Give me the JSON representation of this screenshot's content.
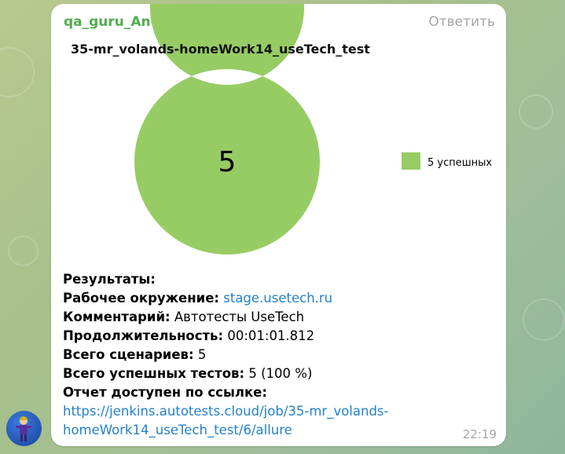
{
  "message": {
    "sender": "qa_guru_AndreQa_bot",
    "reply_label": "Ответить",
    "time": "22:19"
  },
  "chart_data": {
    "type": "pie",
    "title": "35-mr_volands-homeWork14_useTech_test",
    "center_label": "5",
    "slices": [
      {
        "name": "5 успешных",
        "value": 5,
        "color": "#97cc64"
      }
    ]
  },
  "report": {
    "results_label": "Результаты:",
    "env_label": "Рабочее окружение:",
    "env_value": "stage.usetech.ru",
    "comment_label": "Комментарий:",
    "comment_value": "Автотесты UseTech",
    "duration_label": "Продолжительность:",
    "duration_value": "00:01:01.812",
    "scenarios_label": "Всего сценариев:",
    "scenarios_value": "5",
    "passed_label": "Всего успешных тестов:",
    "passed_value": "5 (100 %)",
    "link_label": "Отчет доступен по ссылке:",
    "link_line1": "https://jenkins.autotests.cloud/job/35-mr_volands-",
    "link_line2": "homeWork14_useTech_test/6/allure"
  },
  "colors": {
    "sender": "#4fae4e",
    "link": "#2481cc",
    "ring": "#97cc64",
    "muted": "#a5a5a5"
  },
  "avatar": {
    "icon": "person-avatar-icon"
  }
}
